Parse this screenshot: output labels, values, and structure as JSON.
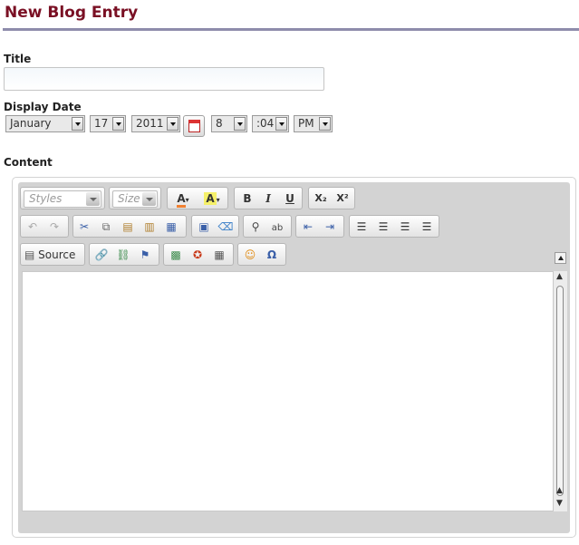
{
  "page": {
    "title": "New Blog Entry"
  },
  "form": {
    "title_label": "Title",
    "title_value": "",
    "date_label": "Display Date",
    "month": "January",
    "day": "17",
    "year": "2011",
    "hour": "8",
    "minute": ":04",
    "ampm": "PM",
    "content_label": "Content"
  },
  "toolbar": {
    "styles_placeholder": "Styles",
    "size_placeholder": "Size",
    "bold": "B",
    "italic": "I",
    "underline": "U",
    "subscript": "X₂",
    "superscript": "X²",
    "source_label": "Source"
  },
  "icons": {
    "text_color": "text-color-icon",
    "bg_color": "background-color-icon",
    "calendar": "calendar-icon"
  },
  "colors": {
    "title": "#7a1024",
    "rule": "#8e8cab"
  }
}
